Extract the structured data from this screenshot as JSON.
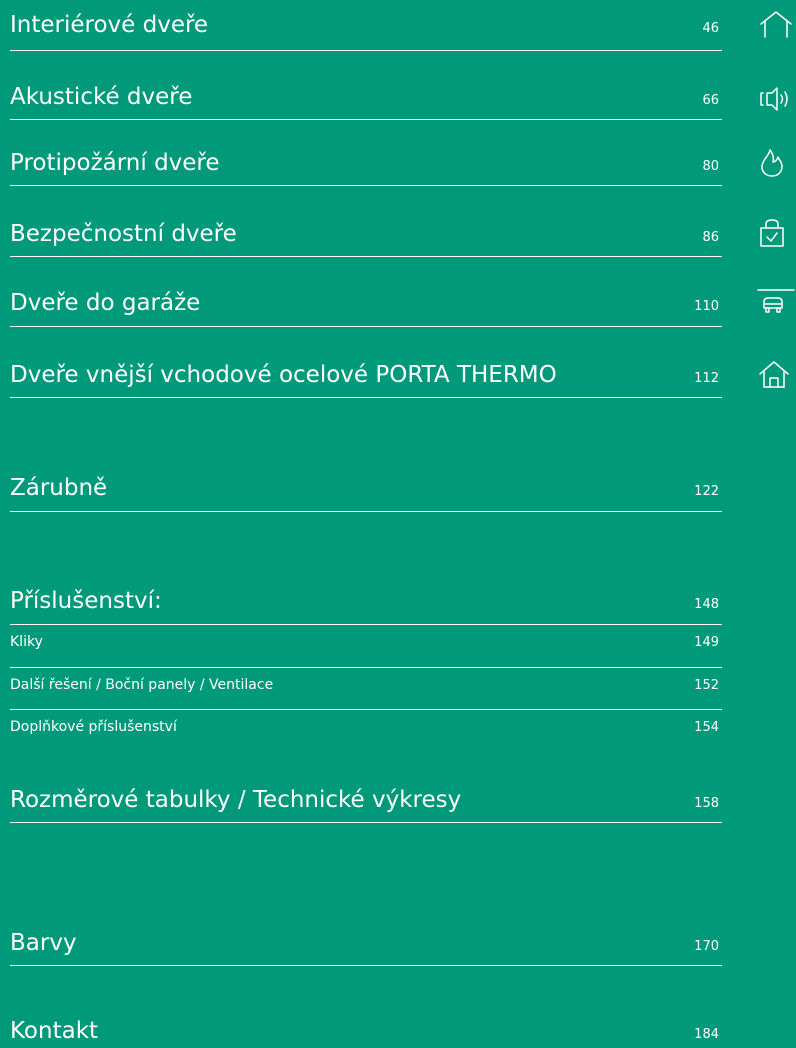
{
  "toc": {
    "interior": {
      "label": "Interiérové dveře",
      "page": "46"
    },
    "acoustic": {
      "label": "Akustické dveře",
      "page": "66"
    },
    "fire": {
      "label": "Protipožární dveře",
      "page": "80"
    },
    "security": {
      "label": "Bezpečnostní dveře",
      "page": "86"
    },
    "garage": {
      "label": "Dveře do garáže",
      "page": "110"
    },
    "exterior": {
      "label": "Dveře vnější vchodové ocelové PORTA THERMO",
      "page": "112"
    },
    "frames": {
      "label": "Zárubně",
      "page": "122"
    },
    "accessories": {
      "label": "Příslušenství:",
      "page": "148"
    },
    "handles": {
      "label": "Kliky",
      "page": "149"
    },
    "other": {
      "label": "Další řešení / Boční panely / Ventilace",
      "page": "152"
    },
    "extra": {
      "label": "Doplňkové příslušenství",
      "page": "154"
    },
    "tables": {
      "label": "Rozměrové tabulky / Technické výkresy",
      "page": "158"
    },
    "colors": {
      "label": "Barvy",
      "page": "170"
    },
    "contact": {
      "label": "Kontakt",
      "page": "184"
    }
  },
  "icons": [
    "house-outline-icon",
    "speaker-sound-icon",
    "flame-icon",
    "lock-shield-icon",
    "garage-car-icon",
    "home-door-icon"
  ],
  "colors": {
    "background": "#00997a",
    "foreground": "#ffffff"
  }
}
